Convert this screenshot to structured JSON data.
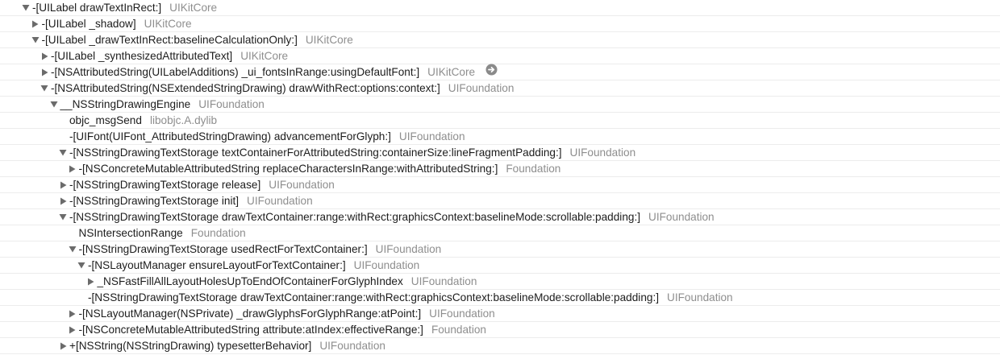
{
  "call_tree": {
    "rows": [
      {
        "depth": 0,
        "disclosure": "expanded",
        "symbol": "-[UILabel drawTextInRect:]",
        "library": "UIKitCore"
      },
      {
        "depth": 1,
        "disclosure": "collapsed",
        "symbol": "-[UILabel _shadow]",
        "library": "UIKitCore"
      },
      {
        "depth": 1,
        "disclosure": "expanded",
        "symbol": "-[UILabel _drawTextInRect:baselineCalculationOnly:]",
        "library": "UIKitCore"
      },
      {
        "depth": 2,
        "disclosure": "collapsed",
        "symbol": "-[UILabel _synthesizedAttributedText]",
        "library": "UIKitCore"
      },
      {
        "depth": 2,
        "disclosure": "collapsed",
        "symbol": "-[NSAttributedString(UILabelAdditions) _ui_fontsInRange:usingDefaultFont:]",
        "library": "UIKitCore",
        "jump_icon": "arrow-right-circle-icon"
      },
      {
        "depth": 2,
        "disclosure": "expanded",
        "symbol": "-[NSAttributedString(NSExtendedStringDrawing) drawWithRect:options:context:]",
        "library": "UIFoundation"
      },
      {
        "depth": 3,
        "disclosure": "expanded",
        "symbol": "__NSStringDrawingEngine",
        "library": "UIFoundation"
      },
      {
        "depth": 4,
        "disclosure": "none",
        "symbol": "objc_msgSend",
        "library": "libobjc.A.dylib"
      },
      {
        "depth": 4,
        "disclosure": "none",
        "symbol": "-[UIFont(UIFont_AttributedStringDrawing) advancementForGlyph:]",
        "library": "UIFoundation"
      },
      {
        "depth": 4,
        "disclosure": "expanded",
        "symbol": "-[NSStringDrawingTextStorage textContainerForAttributedString:containerSize:lineFragmentPadding:]",
        "library": "UIFoundation"
      },
      {
        "depth": 5,
        "disclosure": "collapsed",
        "symbol": "-[NSConcreteMutableAttributedString replaceCharactersInRange:withAttributedString:]",
        "library": "Foundation"
      },
      {
        "depth": 4,
        "disclosure": "collapsed",
        "symbol": "-[NSStringDrawingTextStorage release]",
        "library": "UIFoundation"
      },
      {
        "depth": 4,
        "disclosure": "collapsed",
        "symbol": "-[NSStringDrawingTextStorage init]",
        "library": "UIFoundation"
      },
      {
        "depth": 4,
        "disclosure": "expanded",
        "symbol": "-[NSStringDrawingTextStorage drawTextContainer:range:withRect:graphicsContext:baselineMode:scrollable:padding:]",
        "library": "UIFoundation"
      },
      {
        "depth": 5,
        "disclosure": "none",
        "symbol": "NSIntersectionRange",
        "library": "Foundation"
      },
      {
        "depth": 5,
        "disclosure": "expanded",
        "symbol": "-[NSStringDrawingTextStorage usedRectForTextContainer:]",
        "library": "UIFoundation"
      },
      {
        "depth": 6,
        "disclosure": "expanded",
        "symbol": "-[NSLayoutManager ensureLayoutForTextContainer:]",
        "library": "UIFoundation"
      },
      {
        "depth": 7,
        "disclosure": "collapsed",
        "symbol": "_NSFastFillAllLayoutHolesUpToEndOfContainerForGlyphIndex",
        "library": "UIFoundation"
      },
      {
        "depth": 6,
        "disclosure": "none",
        "symbol": "-[NSStringDrawingTextStorage drawTextContainer:range:withRect:graphicsContext:baselineMode:scrollable:padding:]",
        "library": "UIFoundation"
      },
      {
        "depth": 5,
        "disclosure": "collapsed",
        "symbol": "-[NSLayoutManager(NSPrivate) _drawGlyphsForGlyphRange:atPoint:]",
        "library": "UIFoundation"
      },
      {
        "depth": 5,
        "disclosure": "collapsed",
        "symbol": "-[NSConcreteMutableAttributedString attribute:atIndex:effectiveRange:]",
        "library": "Foundation"
      },
      {
        "depth": 4,
        "disclosure": "collapsed",
        "symbol": "+[NSString(NSStringDrawing) typesetterBehavior]",
        "library": "UIFoundation"
      }
    ]
  }
}
